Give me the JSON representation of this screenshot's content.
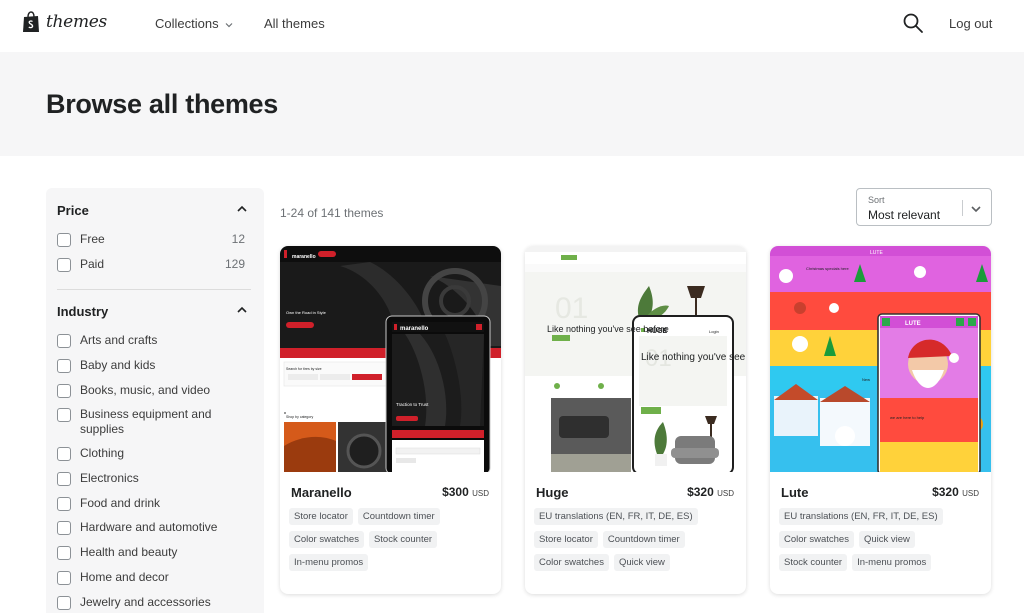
{
  "header": {
    "logo_text": "themes",
    "nav": {
      "collections": "Collections",
      "all_themes": "All themes"
    },
    "logout": "Log out"
  },
  "hero": {
    "title": "Browse all themes"
  },
  "filters": {
    "price": {
      "title": "Price",
      "options": [
        {
          "label": "Free",
          "count": "12"
        },
        {
          "label": "Paid",
          "count": "129"
        }
      ]
    },
    "industry": {
      "title": "Industry",
      "options": [
        {
          "label": "Arts and crafts"
        },
        {
          "label": "Baby and kids"
        },
        {
          "label": "Books, music, and video"
        },
        {
          "label": "Business equipment and supplies"
        },
        {
          "label": "Clothing"
        },
        {
          "label": "Electronics"
        },
        {
          "label": "Food and drink"
        },
        {
          "label": "Hardware and automotive"
        },
        {
          "label": "Health and beauty"
        },
        {
          "label": "Home and decor"
        },
        {
          "label": "Jewelry and accessories"
        }
      ]
    }
  },
  "results": {
    "count_text": "1-24 of 141 themes"
  },
  "sort": {
    "caption": "Sort",
    "value": "Most relevant"
  },
  "themes": [
    {
      "name": "Maranello",
      "price": "$300",
      "currency": "USD",
      "tags": [
        "Store locator",
        "Countdown timer",
        "Color swatches",
        "Stock counter",
        "In-menu promos"
      ],
      "preview": {
        "brand": "maranello",
        "hero_text": "Own the Road in Style",
        "mobile_text": "Traction to Trust",
        "search_text": "Search for tires by size",
        "shop_text": "Shop by category"
      }
    },
    {
      "name": "Huge",
      "price": "$320",
      "currency": "USD",
      "tags": [
        "EU translations (EN, FR, IT, DE, ES)",
        "Store locator",
        "Countdown timer",
        "Color swatches",
        "Quick view"
      ],
      "preview": {
        "brand": "HUGE",
        "big_number": "01",
        "desktop_headline": "Like nothing you've see before",
        "mobile_headline": "Like nothing you've see before",
        "login_text": "Login"
      }
    },
    {
      "name": "Lute",
      "price": "$320",
      "currency": "USD",
      "tags": [
        "EU translations (EN, FR, IT, DE, ES)",
        "Color swatches",
        "Quick view",
        "Stock counter",
        "In-menu promos"
      ],
      "preview": {
        "brand": "LUTE",
        "banner_text": "Christmas specials here",
        "small_text": "we are here to help",
        "new_label": "New"
      }
    }
  ],
  "colors": {
    "hero_bg": "#f6f6f7",
    "sidebar_bg": "#f6f6f7",
    "maranello_dark": "#111111",
    "maranello_red": "#d0202a",
    "huge_green": "#6fb04a",
    "lute_pink": "#e060e0",
    "lute_red": "#ff4b3e",
    "lute_yellow": "#ffd23a",
    "lute_cyan": "#2fc9f0"
  }
}
